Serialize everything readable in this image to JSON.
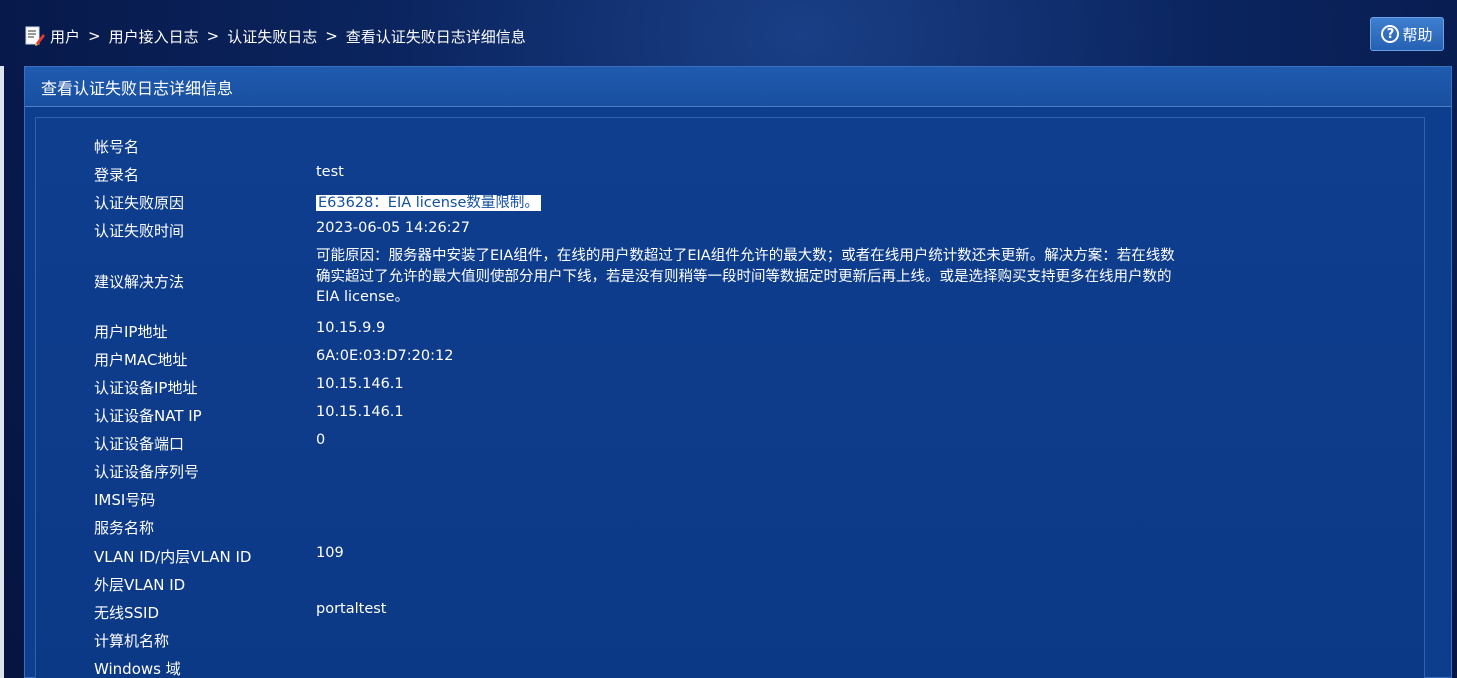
{
  "breadcrumb": {
    "items": [
      "用户",
      "用户接入日志",
      "认证失败日志",
      "查看认证失败日志详细信息"
    ],
    "separator": ">"
  },
  "help_button": {
    "label": "帮助"
  },
  "panel": {
    "title": "查看认证失败日志详细信息"
  },
  "fields": [
    {
      "label": "帐号名",
      "value": ""
    },
    {
      "label": "登录名",
      "value": "test"
    },
    {
      "label": "认证失败原因",
      "value": "E63628：EIA license数量限制。"
    },
    {
      "label": "认证失败时间",
      "value": "2023-06-05 14:26:27"
    },
    {
      "label": "建议解决方法",
      "value": "可能原因：服务器中安装了EIA组件，在线的用户数超过了EIA组件允许的最大数；或者在线用户统计数还未更新。解决方案：若在线数确实超过了允许的最大值则使部分用户下线，若是没有则稍等一段时间等数据定时更新后再上线。或是选择购买支持更多在线用户数的EIA license。"
    },
    {
      "label": "用户IP地址",
      "value": "10.15.9.9"
    },
    {
      "label": "用户MAC地址",
      "value": "6A:0E:03:D7:20:12"
    },
    {
      "label": "认证设备IP地址",
      "value": "10.15.146.1"
    },
    {
      "label": "认证设备NAT IP",
      "value": "10.15.146.1"
    },
    {
      "label": "认证设备端口",
      "value": "0"
    },
    {
      "label": "认证设备序列号",
      "value": ""
    },
    {
      "label": "IMSI号码",
      "value": ""
    },
    {
      "label": "服务名称",
      "value": ""
    },
    {
      "label": "VLAN ID/内层VLAN ID",
      "value": "109"
    },
    {
      "label": "外层VLAN ID",
      "value": ""
    },
    {
      "label": "无线SSID",
      "value": "portaltest"
    },
    {
      "label": "计算机名称",
      "value": ""
    },
    {
      "label": "Windows 域",
      "value": ""
    }
  ],
  "colors": {
    "background": "#07194a",
    "panel": "#0d3d8d",
    "panel_header": "#1f5bb0",
    "highlight_bg": "#ffffff",
    "highlight_text": "#1450a0"
  },
  "icons": {
    "breadcrumb": "document-edit-icon",
    "help": "question-circle-icon"
  }
}
